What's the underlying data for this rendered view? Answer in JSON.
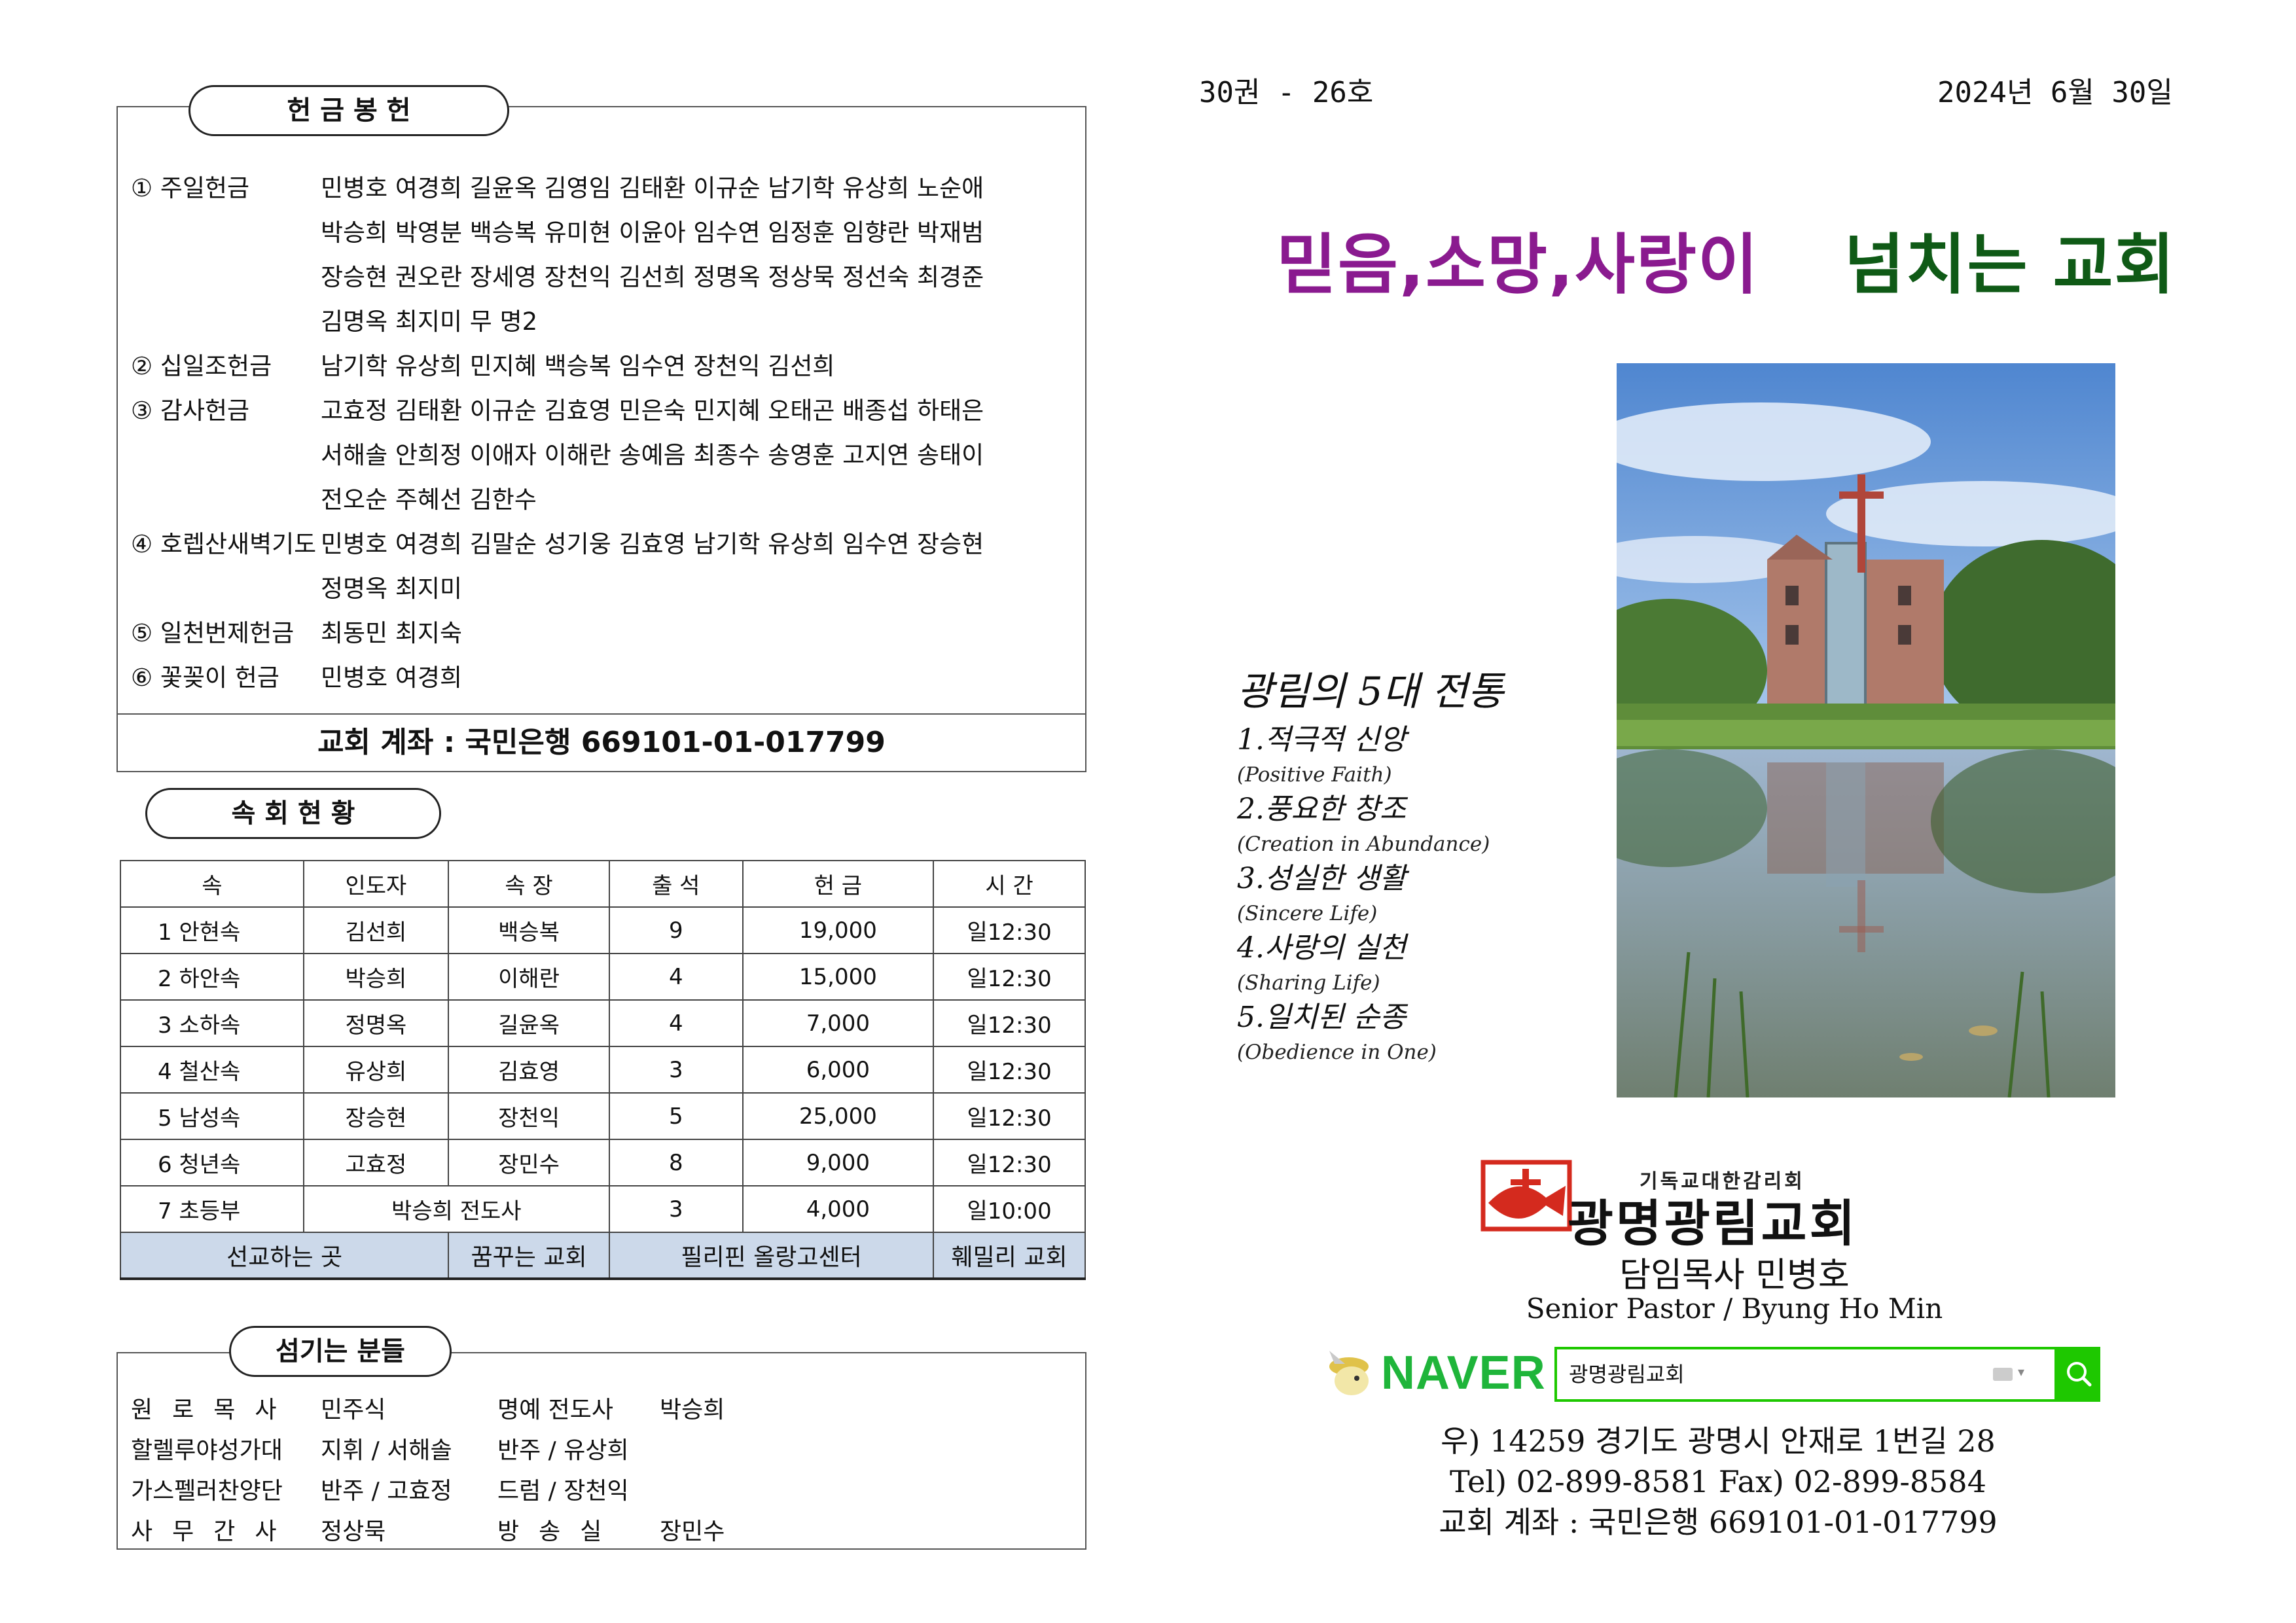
{
  "offering": {
    "title": "헌 금 봉 헌",
    "rows": [
      {
        "label": "① 주일헌금",
        "lines": [
          "민병호 여경희 길윤옥 김영임 김태환 이규순 남기학 유상희 노순애",
          "박승희 박영분 백승복 유미현 이윤아 임수연 임정훈 임향란 박재범",
          "장승현 권오란 장세영 장천익 김선희 정명옥 정상묵 정선숙 최경준",
          "김명옥 최지미 무 명2"
        ]
      },
      {
        "label": "② 십일조헌금",
        "lines": [
          "남기학 유상희 민지혜 백승복 임수연 장천익 김선희"
        ]
      },
      {
        "label": "③ 감사헌금",
        "lines": [
          "고효정 김태환 이규순 김효영 민은숙 민지혜 오태곤 배종섭 하태은",
          "서해솔 안희정 이애자 이해란 송예음 최종수 송영훈 고지연 송태이",
          "전오순 주혜선 김한수"
        ]
      },
      {
        "label": "④ 호렙산새벽기도",
        "lines": [
          "민병호 여경희 김말순 성기웅 김효영 남기학 유상희 임수연 장승현",
          "정명옥 최지미"
        ]
      },
      {
        "label": "⑤ 일천번제헌금",
        "lines": [
          "최동민 최지숙"
        ]
      },
      {
        "label": "⑥ 꽃꽂이 헌금",
        "lines": [
          "민병호 여경희"
        ]
      }
    ],
    "account": "교회 계좌 : 국민은행 669101-01-017799"
  },
  "cells": {
    "title": "속 회 현 황",
    "headers": [
      "속",
      "인도자",
      "속 장",
      "출 석",
      "헌 금",
      "시 간"
    ],
    "rows": [
      [
        "1 안현속",
        "김선희",
        "백승복",
        "9",
        "19,000",
        "일12:30"
      ],
      [
        "2 하안속",
        "박승희",
        "이해란",
        "4",
        "15,000",
        "일12:30"
      ],
      [
        "3 소하속",
        "정명옥",
        "길윤옥",
        "4",
        "7,000",
        "일12:30"
      ],
      [
        "4 철산속",
        "유상희",
        "김효영",
        "3",
        "6,000",
        "일12:30"
      ],
      [
        "5 남성속",
        "장승현",
        "장천익",
        "5",
        "25,000",
        "일12:30"
      ],
      [
        "6 청년속",
        "고효정",
        "장민수",
        "8",
        "9,000",
        "일12:30"
      ]
    ],
    "row7": {
      "name": "7 초등부",
      "leader": "박승희 전도사",
      "attend": "3",
      "amount": "4,000",
      "time": "일10:00"
    },
    "mission": {
      "label": "선교하는 곳",
      "m1": "꿈꾸는 교회",
      "m2": "필리핀 올랑고센터",
      "m3": "훼밀리 교회"
    }
  },
  "servants": {
    "title": "섬기는 분들",
    "rows": [
      [
        "원로목사",
        "민주식",
        "명예 전도사",
        "박승희"
      ],
      [
        "할렐루야성가대",
        "지휘 / 서해솔",
        "반주 / 유상희",
        ""
      ],
      [
        "가스펠러찬양단",
        "반주 / 고효정",
        "드럼 / 장천익",
        ""
      ],
      [
        "사무간사",
        "정상묵",
        "방송실",
        "장민수"
      ]
    ]
  },
  "header": {
    "volume": "30권 - 26호",
    "date": "2024년 6월 30일"
  },
  "slogan": {
    "part1": "믿음,소망,사랑이",
    "part2": "넘치는 교회"
  },
  "traditions": {
    "title": "광림의 5대 전통",
    "items": [
      {
        "kr": "1.적극적 신앙",
        "en": "(Positive Faith)"
      },
      {
        "kr": "2.풍요한 창조",
        "en": "(Creation in Abundance)"
      },
      {
        "kr": "3.성실한 생활",
        "en": "(Sincere Life)"
      },
      {
        "kr": "4.사랑의 실천",
        "en": "(Sharing Life)"
      },
      {
        "kr": "5.일치된 순종",
        "en": "(Obedience in One)"
      }
    ]
  },
  "church": {
    "denomination": "기독교대한감리회",
    "name": "광명광림교회",
    "pastor_kr": "담임목사 민병호",
    "pastor_en": "Senior Pastor / Byung Ho Min"
  },
  "naver": {
    "brand": "NAVER",
    "query": "광명광림교회"
  },
  "address": {
    "line1": "우) 14259 경기도 광명시 안재로 1번길 28",
    "line2": "Tel) 02-899-8581 Fax) 02-899-8584",
    "line3": "교회 계좌 : 국민은행 669101-01-017799"
  },
  "colors": {
    "slogan_purple": "#8a1a8f",
    "slogan_green": "#0f5a16",
    "naver_green": "#1ec800",
    "mission_row": "#ccd9ea",
    "logo_red": "#d42a1e"
  }
}
